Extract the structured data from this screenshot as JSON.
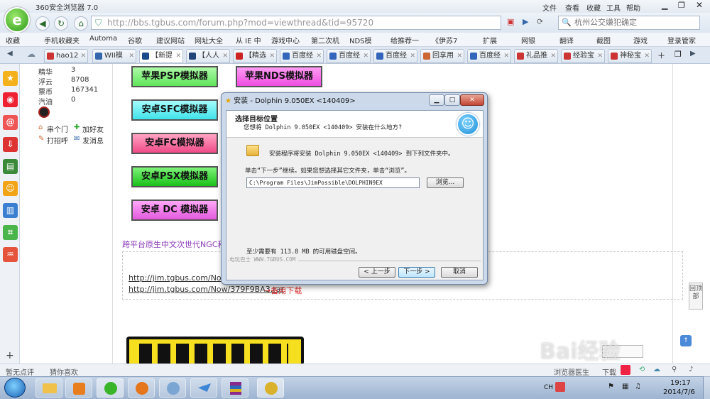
{
  "browser": {
    "title": "360安全浏览器 7.0",
    "menu": [
      "文件",
      "查看",
      "收藏",
      "工具",
      "帮助"
    ],
    "address": "http://bbs.tgbus.com/forum.php?mod=viewthread&tid=95720",
    "address_domain": "bbs.tgbus.com",
    "search_text": "杭州公交嫌犯确定",
    "favorites": [
      "收藏",
      "手机收藏夹",
      "Automa",
      "谷歌",
      "建议网站",
      "网址大全",
      "从 IE 中",
      "游戏中心",
      "第二次机",
      "NDS模",
      "给推荐一",
      "《伊苏7"
    ],
    "fav_right": [
      "扩展",
      "网银",
      "翻译",
      "截图",
      "游戏",
      "登录管家"
    ],
    "tabs": [
      "hao12",
      "WII模",
      "【新提",
      "【人人",
      "【精选",
      "百度经",
      "百度经",
      "百度经",
      "回享用",
      "百度经",
      "礼品推",
      "经验宝",
      "神秘宝"
    ]
  },
  "profile": {
    "rows": [
      {
        "label": "精华",
        "value": "3"
      },
      {
        "label": "浮云",
        "value": "8708"
      },
      {
        "label": "票币",
        "value": "167341"
      },
      {
        "label": "汽油",
        "value": "0"
      }
    ],
    "actions": [
      "串个门",
      "加好友",
      "打招呼",
      "发消息"
    ]
  },
  "buttons": {
    "b1": "苹果PSP模拟器",
    "b2": "苹果NDS模拟器",
    "b3": "安卓SFC模拟器",
    "b4": "安卓FC模拟器",
    "b5": "安卓PSX模拟器",
    "b6": "安卓 DC 模拟器"
  },
  "post": {
    "purple_text": "跨平台原生中文次世代NGC和W",
    "link1": "http://jim.tgbus.com/Now/Do",
    "link2": "http://jim.tgbus.com/Now/379F9BA3.rar",
    "link2_note": "→备用下载"
  },
  "dialog": {
    "title": "安装 - Dolphin 9.050EX <140409>",
    "heading": "选择目标位置",
    "subheading": "您想将 Dolphin 9.050EX <140409> 安装在什么地方?",
    "info": "安装程序将安装 Dolphin 9.050EX <140409> 到下列文件夹中。",
    "instruction": "单击“下一步”继续。如果您想选择其它文件夹，单击“浏览”。",
    "path": "C:\\Program Files\\JimPossible\\DOLPHIN9EX",
    "browse": "浏览...",
    "disk_space": "至少需要有 113.8 MB 的可用磁盘空间。",
    "brand": "电玩巴士 WWW.TGBUS.COM",
    "back": "< 上一步",
    "next": "下一步 >",
    "cancel": "取消"
  },
  "statusbar": {
    "left1": "暂无点评",
    "left2": "猜你喜欢",
    "r1": "浏览器医生",
    "r2": "下载"
  },
  "taskbar": {
    "time": "19:17",
    "date": "2014/7/6",
    "lang": "CH"
  },
  "watermark": "Bai经验",
  "side_float": "回顶部"
}
